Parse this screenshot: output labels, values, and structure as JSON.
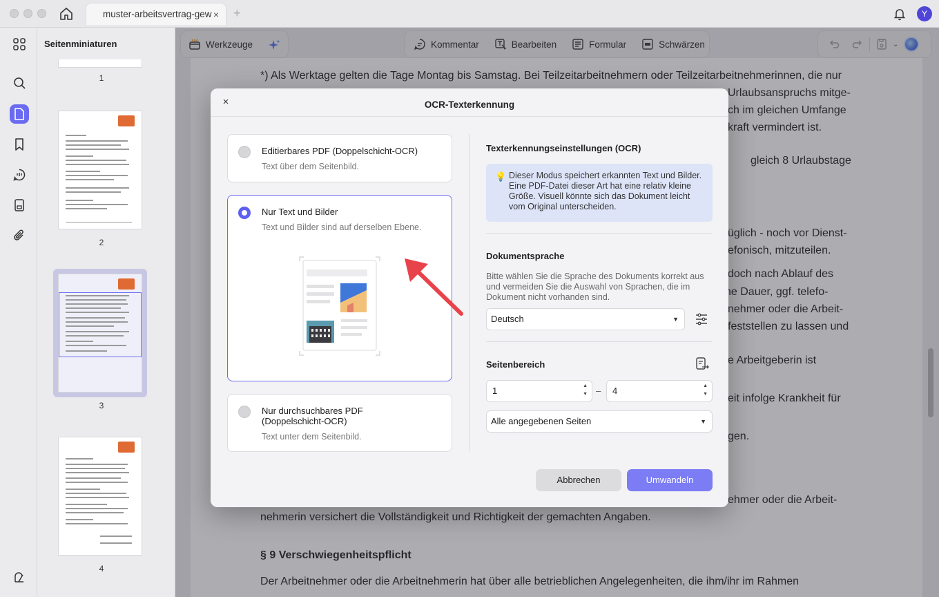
{
  "window": {
    "tab_title": "muster-arbeitsvertrag-gew",
    "tab_close": "×",
    "tab_new": "+",
    "avatar_letter": "Y"
  },
  "thumbnails": {
    "title": "Seitenminiaturen",
    "pages": [
      "1",
      "2",
      "3",
      "4"
    ],
    "selected_page": "3"
  },
  "toolbar": {
    "tools_label": "Werkzeuge",
    "comment_label": "Kommentar",
    "edit_label": "Bearbeiten",
    "form_label": "Formular",
    "redact_label": "Schwärzen"
  },
  "document": {
    "lines": [
      "*) Als Werktage gelten die Tage Montag bis Samstag. Bei Teilzeitarbeitnehmern oder Teilzeitarbeitnehmerinnen, die nur",
      "Urlaubsanspruchs mitge-",
      "ch im gleichen Umfange",
      "kraft vermindert ist.",
      "gleich 8 Urlaubstage",
      "züglich - noch vor Dienst-",
      "efonisch, mitzuteilen.",
      "doch nach Ablauf des",
      "he Dauer, ggf. telefo-",
      "nehmer oder die Arbeit-",
      "feststellen zu lassen und",
      "e Arbeitgeberin ist",
      "eit infolge Krankheit für",
      "gen.",
      "ehmer oder die Arbeit-",
      "nehmerin versichert die Vollständigkeit und Richtigkeit der gemachten Angaben.",
      "§ 9 Verschwiegenheitspflicht",
      "Der Arbeitnehmer oder die Arbeitnehmerin hat über alle betrieblichen Angelegenheiten, die ihm/ihr im Rahmen"
    ]
  },
  "dialog": {
    "title": "OCR-Texterkennung",
    "close": "×",
    "options": [
      {
        "title": "Editierbares PDF (Doppelschicht-OCR)",
        "subtitle": "Text über dem Seitenbild.",
        "selected": false
      },
      {
        "title": "Nur Text und Bilder",
        "subtitle": "Text und Bilder sind auf derselben Ebene.",
        "selected": true
      },
      {
        "title": "Nur durchsuchbares PDF (Doppelschicht-OCR)",
        "subtitle": "Text unter dem Seitenbild.",
        "selected": false
      }
    ],
    "settings_title": "Texterkennungseinstellungen (OCR)",
    "info_text": "Dieser Modus speichert erkannten Text und Bilder. Eine PDF-Datei dieser Art hat eine relativ kleine Größe. Visuell könnte sich das Dokument leicht vom Original unterscheiden.",
    "language_title": "Dokumentsprache",
    "language_desc": "Bitte wählen Sie die Sprache des Dokuments korrekt aus und vermeiden Sie die Auswahl von Sprachen, die im Dokument nicht vorhanden sind.",
    "language_value": "Deutsch",
    "range_title": "Seitenbereich",
    "range_from": "1",
    "range_dash": "–",
    "range_to": "4",
    "range_mode": "Alle angegebenen Seiten",
    "cancel_label": "Abbrechen",
    "convert_label": "Umwandeln"
  },
  "colors": {
    "accent": "#6b6ef0",
    "primary_button": "#7c7df5",
    "info_bg": "#dde4f8",
    "annotation_arrow": "#e8434a"
  },
  "icons": {
    "home": "home-icon",
    "bell": "bell-icon",
    "grid": "grid-icon",
    "search": "search-icon",
    "page": "page-icon",
    "bookmark": "bookmark-icon",
    "comment": "comment-icon",
    "form": "form-icon",
    "attachment": "paperclip-icon",
    "ai": "sparkle-icon"
  }
}
